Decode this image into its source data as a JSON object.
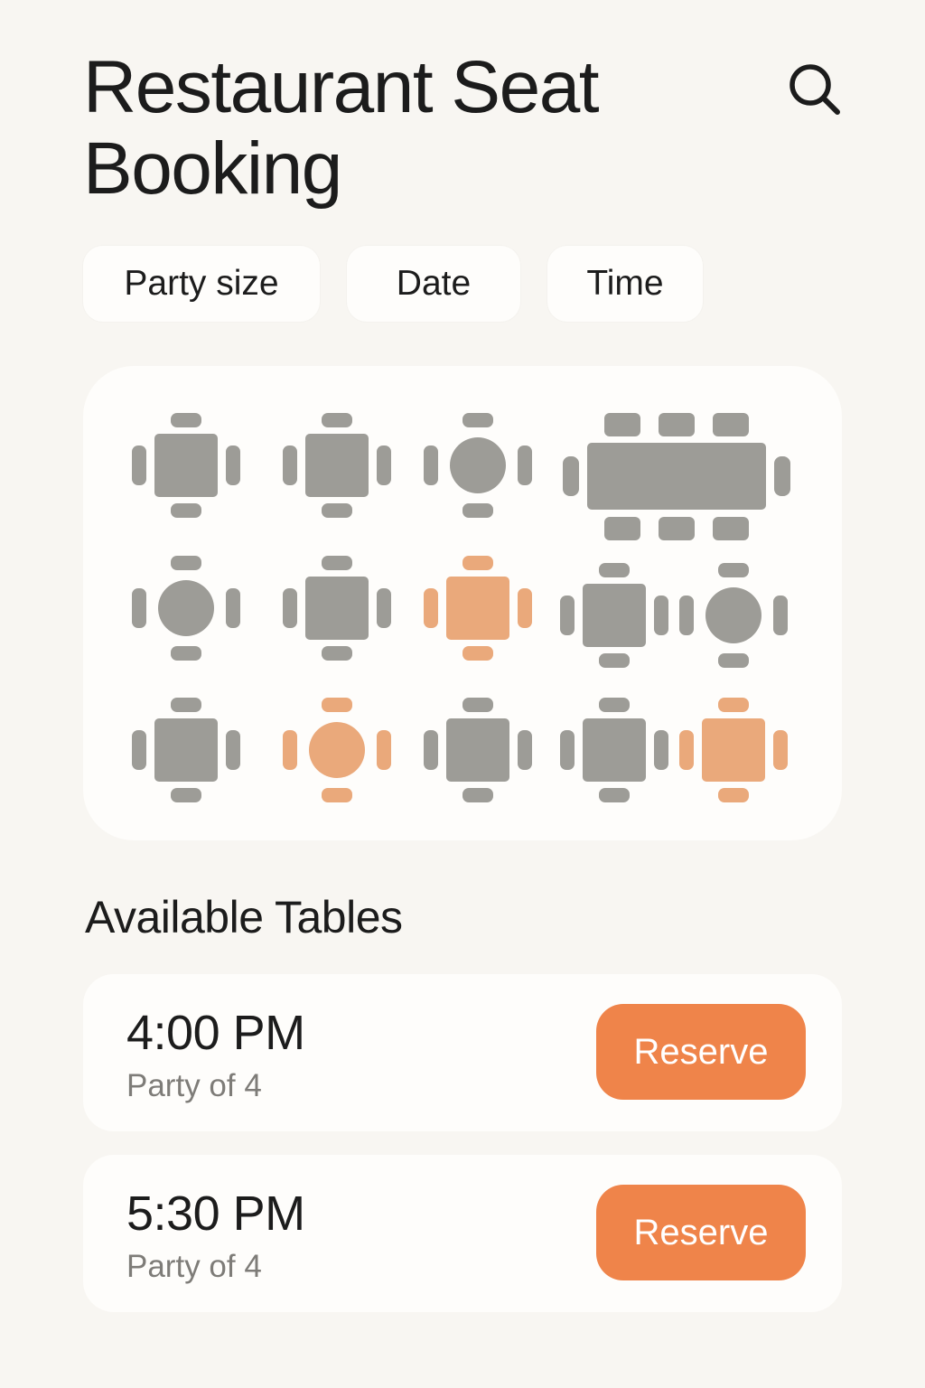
{
  "header": {
    "title": "Restaurant Seat Booking",
    "search_icon": "search-icon"
  },
  "filters": [
    {
      "label": "Party size"
    },
    {
      "label": "Date"
    },
    {
      "label": "Time"
    }
  ],
  "colors": {
    "background": "#f8f6f2",
    "card": "#fefdfb",
    "table_unavailable": "#9d9c97",
    "table_available": "#eaa97b",
    "accent": "#ef844a",
    "muted_text": "#7e7c78"
  },
  "floor_plan": {
    "rows": [
      [
        {
          "shape": "square",
          "status": "unavailable"
        },
        {
          "shape": "square",
          "status": "unavailable"
        },
        {
          "shape": "round",
          "status": "unavailable"
        },
        {
          "shape": "long",
          "status": "unavailable"
        }
      ],
      [
        {
          "shape": "round",
          "status": "unavailable"
        },
        {
          "shape": "square",
          "status": "unavailable"
        },
        {
          "shape": "square",
          "status": "available"
        },
        {
          "shape": "square",
          "status": "unavailable"
        },
        {
          "shape": "round",
          "status": "unavailable"
        }
      ],
      [
        {
          "shape": "square",
          "status": "unavailable"
        },
        {
          "shape": "round",
          "status": "available"
        },
        {
          "shape": "square",
          "status": "unavailable"
        },
        {
          "shape": "square",
          "status": "unavailable"
        },
        {
          "shape": "square",
          "status": "available"
        }
      ]
    ]
  },
  "available": {
    "title": "Available Tables",
    "slots": [
      {
        "time": "4:00 PM",
        "party": "Party of 4",
        "action": "Reserve"
      },
      {
        "time": "5:30 PM",
        "party": "Party of 4",
        "action": "Reserve"
      }
    ]
  }
}
